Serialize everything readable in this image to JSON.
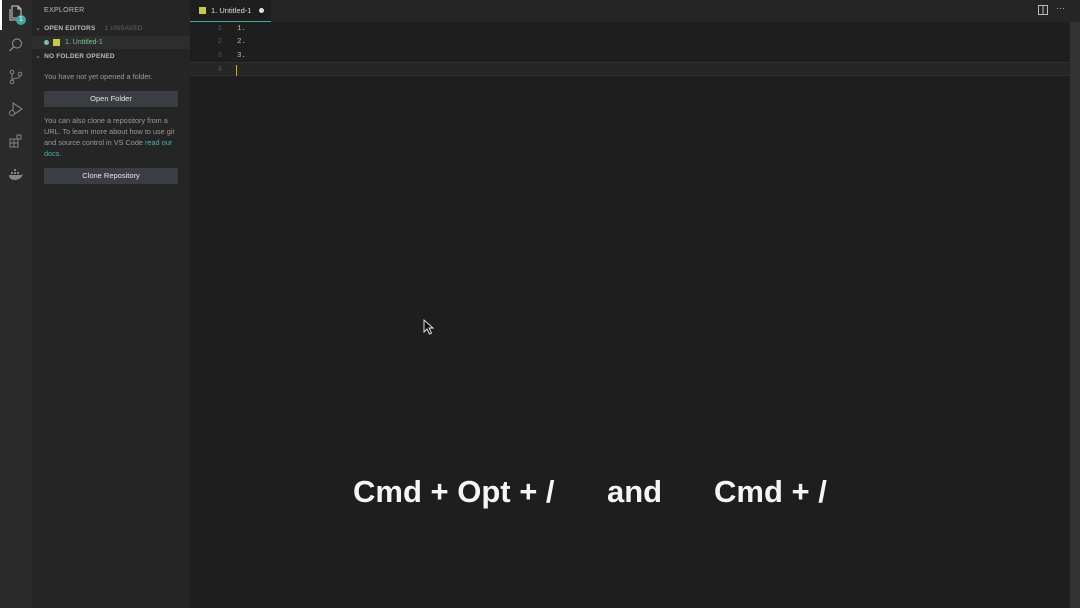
{
  "sidebar": {
    "title": "EXPLORER",
    "open_editors": {
      "header": "OPEN EDITORS",
      "status": "1 UNSAVED",
      "file": "1. Untitled-1"
    },
    "no_folder": {
      "header": "NO FOLDER OPENED",
      "message": "You have not yet opened a folder.",
      "open_folder_label": "Open Folder",
      "clone_message": "You can also clone a repository from a URL. To learn more about how to use git and source control in VS Code ",
      "clone_link": "read our docs.",
      "clone_label": "Clone Repository"
    }
  },
  "activity_bar": {
    "explorer_badge": "1"
  },
  "tabs": [
    {
      "label": "1. Untitled-1"
    }
  ],
  "editor": {
    "lines": [
      {
        "number": "1",
        "text": "1."
      },
      {
        "number": "2",
        "text": "2."
      },
      {
        "number": "3",
        "text": "3."
      },
      {
        "number": "4",
        "text": ""
      }
    ]
  },
  "overlay": {
    "shortcut_1": "Cmd + Opt + /",
    "connector": "and",
    "shortcut_2": "Cmd + /"
  },
  "icons": {
    "activity": [
      "files-icon",
      "search-icon",
      "source-control-icon",
      "run-debug-icon",
      "extensions-icon",
      "docker-icon"
    ],
    "tabbar": [
      "split-editor-icon",
      "more-actions-icon"
    ]
  },
  "colors": {
    "accent": "#41a6a2",
    "modified": "#73c991",
    "code_text": "#d7ba7d",
    "js_icon": "#cbcb41"
  }
}
